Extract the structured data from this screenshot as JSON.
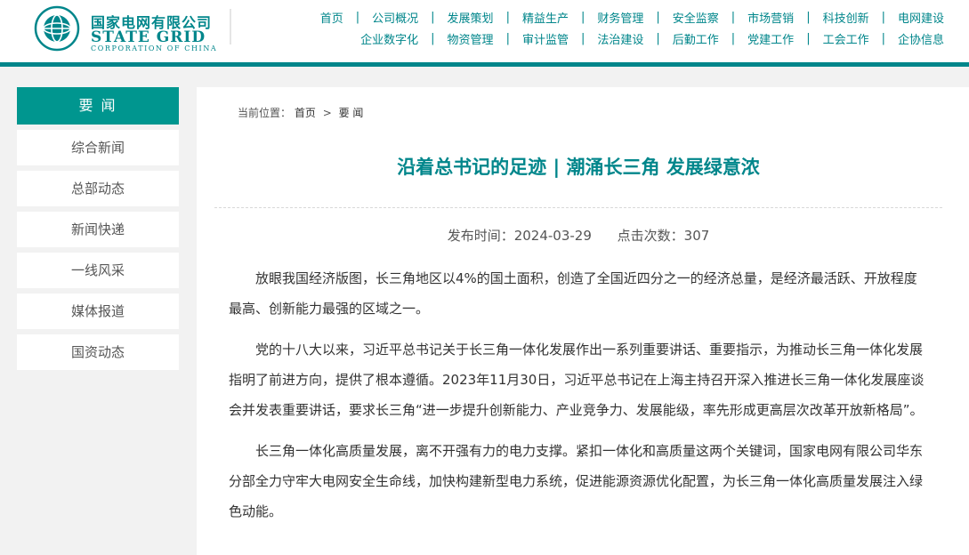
{
  "header": {
    "logo_cn": "国家电网有限公司",
    "logo_en": "STATE GRID",
    "logo_en_sub": "CORPORATION OF CHINA",
    "brand_color": "#00868b",
    "nav_row1": [
      "首页",
      "公司概况",
      "发展策划",
      "精益生产",
      "财务管理",
      "安全监察",
      "市场营销",
      "科技创新",
      "电网建设"
    ],
    "nav_row2": [
      "企业数字化",
      "物资管理",
      "审计监管",
      "法治建设",
      "后勤工作",
      "党建工作",
      "工会工作",
      "企协信息"
    ]
  },
  "sidebar": {
    "heading": "要 闻",
    "items": [
      "综合新闻",
      "总部动态",
      "新闻快递",
      "一线风采",
      "媒体报道",
      "国资动态"
    ]
  },
  "breadcrumb": {
    "label": "当前位置：",
    "home": "首页",
    "separator": ">",
    "current": "要 闻"
  },
  "article": {
    "title": "沿着总书记的足迹 | 潮涌长三角 发展绿意浓",
    "publish_time": "发布时间：2024-03-29",
    "click_count": "点击次数：307",
    "paragraphs": [
      "放眼我国经济版图，长三角地区以4%的国土面积，创造了全国近四分之一的经济总量，是经济最活跃、开放程度最高、创新能力最强的区域之一。",
      "党的十八大以来，习近平总书记关于长三角一体化发展作出一系列重要讲话、重要指示，为推动长三角一体化发展指明了前进方向，提供了根本遵循。2023年11月30日，习近平总书记在上海主持召开深入推进长三角一体化发展座谈会并发表重要讲话，要求长三角“进一步提升创新能力、产业竞争力、发展能级，率先形成更高层次改革开放新格局”。",
      "长三角一体化高质量发展，离不开强有力的电力支撑。紧扣一体化和高质量这两个关键词，国家电网有限公司华东分部全力守牢大电网安全生命线，加快构建新型电力系统，促进能源资源优化配置，为长三角一体化高质量发展注入绿色动能。"
    ]
  }
}
